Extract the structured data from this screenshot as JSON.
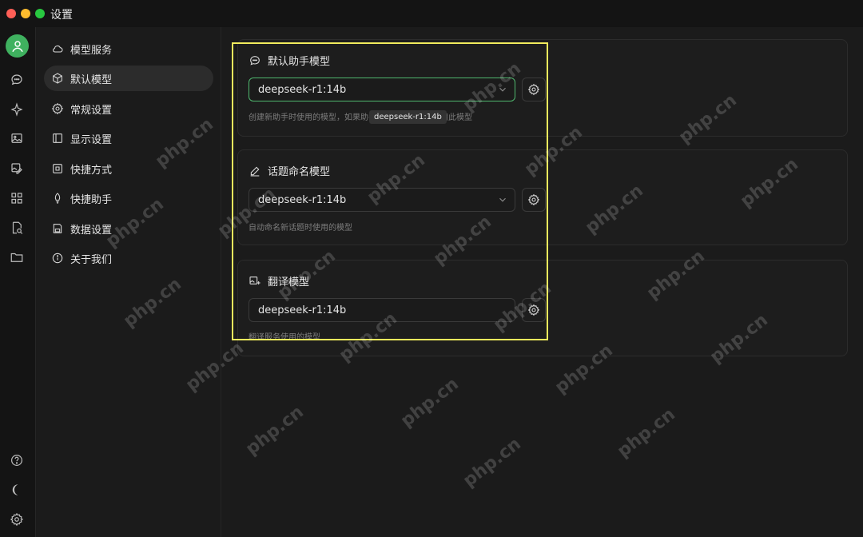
{
  "window": {
    "title": "设置"
  },
  "icon_bar": {
    "items": [
      {
        "icon": "chat-bubble-icon"
      },
      {
        "icon": "sparkle-icon"
      },
      {
        "icon": "image-icon"
      },
      {
        "icon": "image-edit-icon"
      },
      {
        "icon": "grid-apps-icon"
      },
      {
        "icon": "doc-search-icon"
      },
      {
        "icon": "folder-icon"
      }
    ],
    "bottom": [
      {
        "icon": "help-icon"
      },
      {
        "icon": "moon-icon"
      },
      {
        "icon": "gear-icon"
      }
    ]
  },
  "settings_nav": {
    "items": [
      {
        "label": "模型服务",
        "icon": "cloud-icon"
      },
      {
        "label": "默认模型",
        "icon": "cube-icon",
        "active": true
      },
      {
        "label": "常规设置",
        "icon": "gear-icon"
      },
      {
        "label": "显示设置",
        "icon": "layout-icon"
      },
      {
        "label": "快捷方式",
        "icon": "command-icon"
      },
      {
        "label": "快捷助手",
        "icon": "rocket-icon"
      },
      {
        "label": "数据设置",
        "icon": "save-icon"
      },
      {
        "label": "关于我们",
        "icon": "info-icon"
      }
    ]
  },
  "sections": [
    {
      "title": "默认助手模型",
      "icon": "chat-bubble-icon",
      "selected_model": "deepseek-r1:14b",
      "hint": "创建新助手时使用的模型，如果助手未设置模型，则使用此模型",
      "tooltip": "deepseek-r1:14b"
    },
    {
      "title": "话题命名模型",
      "icon": "pencil-icon",
      "selected_model": "deepseek-r1:14b",
      "hint": "自动命名新话题时使用的模型"
    },
    {
      "title": "翻译模型",
      "icon": "image-translate-icon",
      "selected_model": "deepseek-r1:14b",
      "hint": "翻译服务使用的模型"
    }
  ],
  "watermark": "php.cn",
  "colors": {
    "accent": "#4fb76e",
    "highlight": "#f2ec5d",
    "background": "#1b1b1b"
  }
}
